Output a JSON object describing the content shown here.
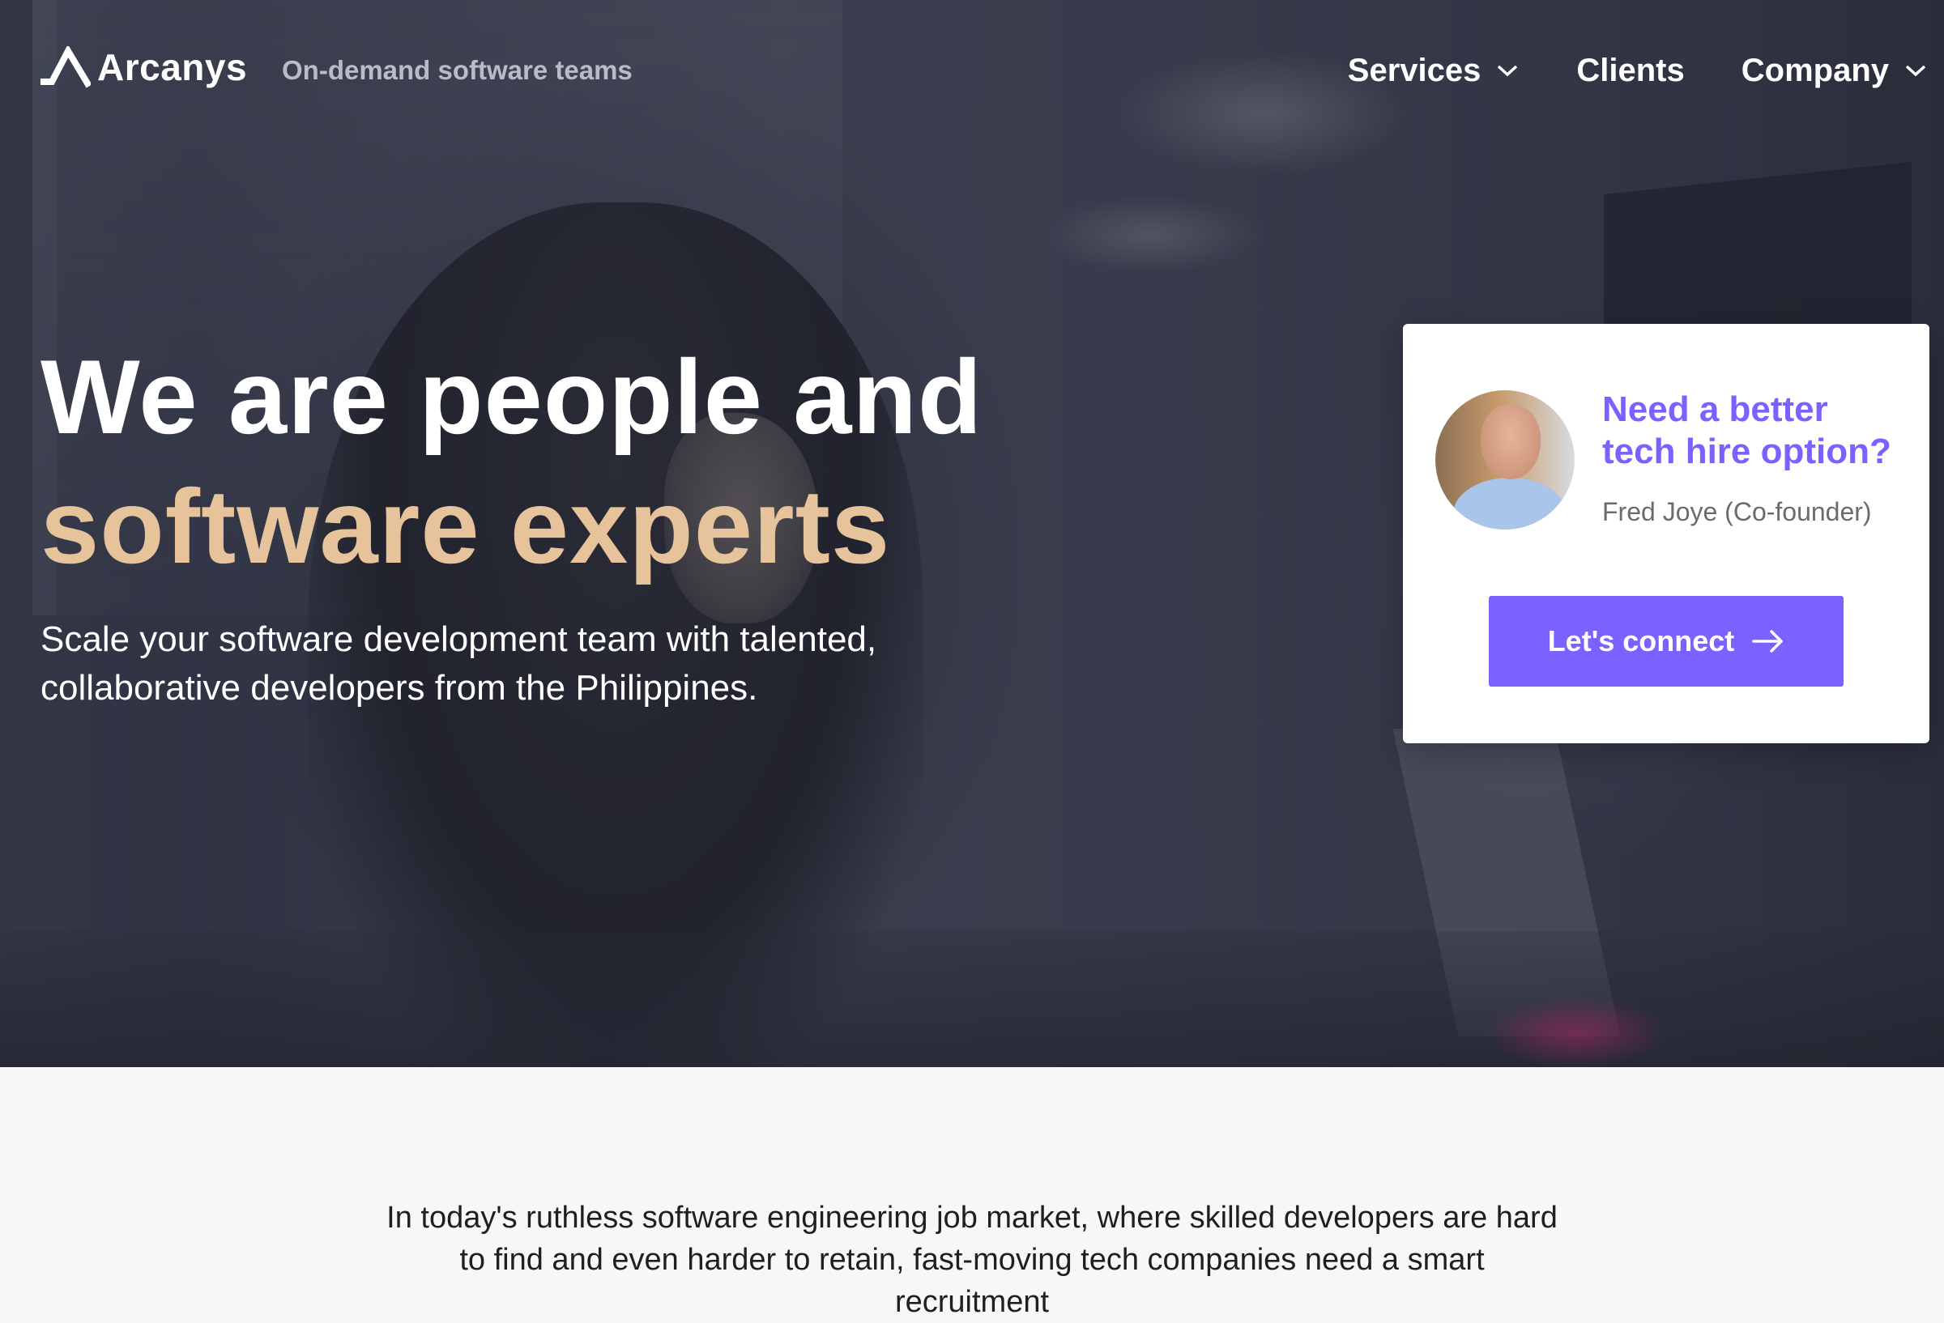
{
  "brand": {
    "name": "Arcanys",
    "tagline": "On-demand software teams"
  },
  "nav": {
    "items": [
      {
        "label": "Services",
        "has_dropdown": true
      },
      {
        "label": "Clients",
        "has_dropdown": false
      },
      {
        "label": "Company",
        "has_dropdown": true
      }
    ]
  },
  "hero": {
    "headline_line1": "We are people and",
    "headline_line2": "software experts",
    "subhead": "Scale your software development team with talented, collaborative developers from the Philippines.",
    "headline_accent_color": "#e6c39a"
  },
  "card": {
    "title": "Need a better tech hire option?",
    "person": "Fred Joye (Co-founder)",
    "cta_label": "Let's connect",
    "cta_icon": "arrow-right-icon",
    "accent_color": "#7b61ff"
  },
  "intro": {
    "text": "In today's ruthless software engineering job market, where skilled developers are hard to find and even harder to retain, fast-moving tech companies need a smart recruitment"
  }
}
